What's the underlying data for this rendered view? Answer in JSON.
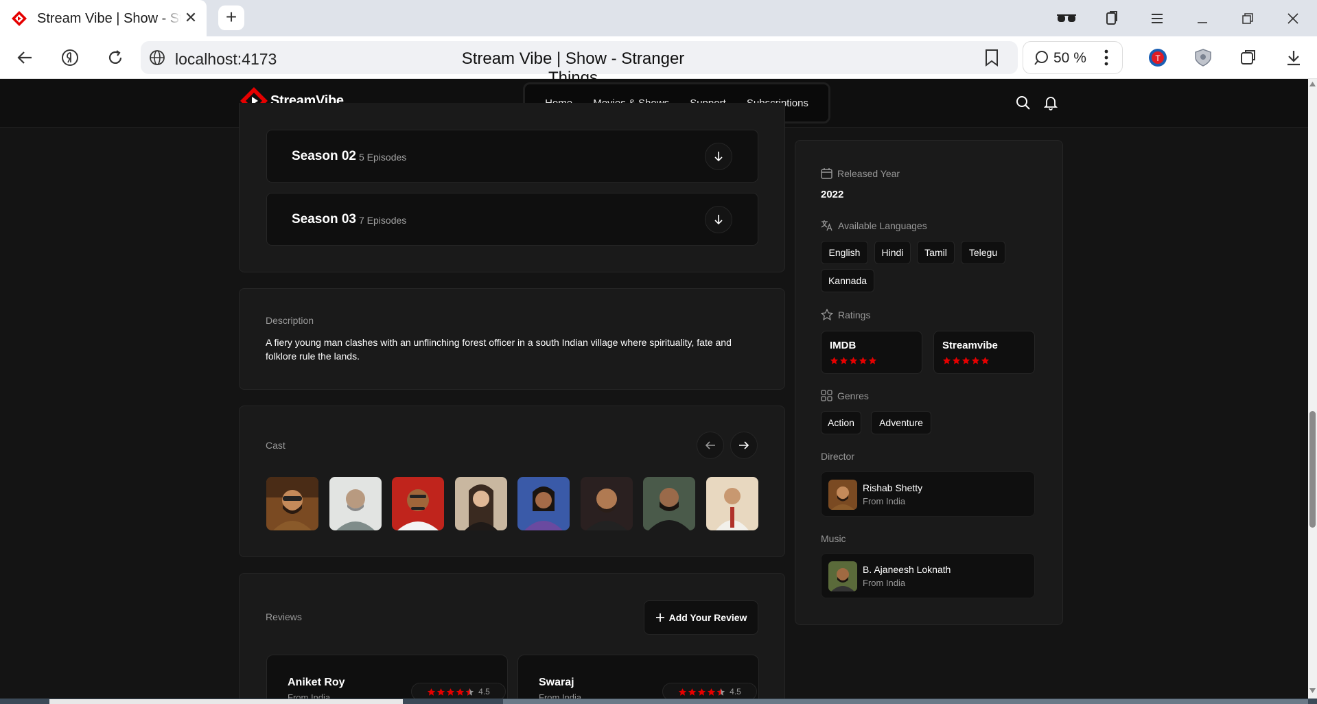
{
  "browser": {
    "tab_title": "Stream Vibe | Show - Stranger Things",
    "url": "localhost:4173",
    "page_title": "Stream Vibe | Show - Stranger Things",
    "zoom": "50 %"
  },
  "site": {
    "logo_text": "StreamVibe",
    "nav": [
      "Home",
      "Movies & Shows",
      "Support",
      "Subscriptions"
    ]
  },
  "seasons": [
    {
      "title": "Season 02",
      "episodes": "5 Episodes"
    },
    {
      "title": "Season 03",
      "episodes": "7 Episodes"
    }
  ],
  "description": {
    "label": "Description",
    "text": "A fiery young man clashes with an unflinching forest officer in a south Indian village where spirituality, fate and folklore rule the lands."
  },
  "cast": {
    "label": "Cast",
    "count": 8
  },
  "reviews": {
    "label": "Reviews",
    "add_label": "Add Your Review",
    "items": [
      {
        "name": "Aniket Roy",
        "from": "From India",
        "rating": "4.5"
      },
      {
        "name": "Swaraj",
        "from": "From India",
        "rating": "4.5"
      }
    ]
  },
  "sidebar": {
    "released_label": "Released Year",
    "released_year": "2022",
    "languages_label": "Available Languages",
    "languages": [
      "English",
      "Hindi",
      "Tamil",
      "Telegu",
      "Kannada"
    ],
    "ratings_label": "Ratings",
    "ratings": [
      {
        "source": "IMDB",
        "stars": 5
      },
      {
        "source": "Streamvibe",
        "stars": 5
      }
    ],
    "genres_label": "Genres",
    "genres": [
      "Action",
      "Adventure"
    ],
    "director_label": "Director",
    "director": {
      "name": "Rishab Shetty",
      "from": "From India"
    },
    "music_label": "Music",
    "music": {
      "name": "B. Ajaneesh Loknath",
      "from": "From India"
    }
  },
  "colors": {
    "accent": "#e50000",
    "background": "#141414",
    "panel": "#1a1a1a",
    "border": "#262626"
  }
}
